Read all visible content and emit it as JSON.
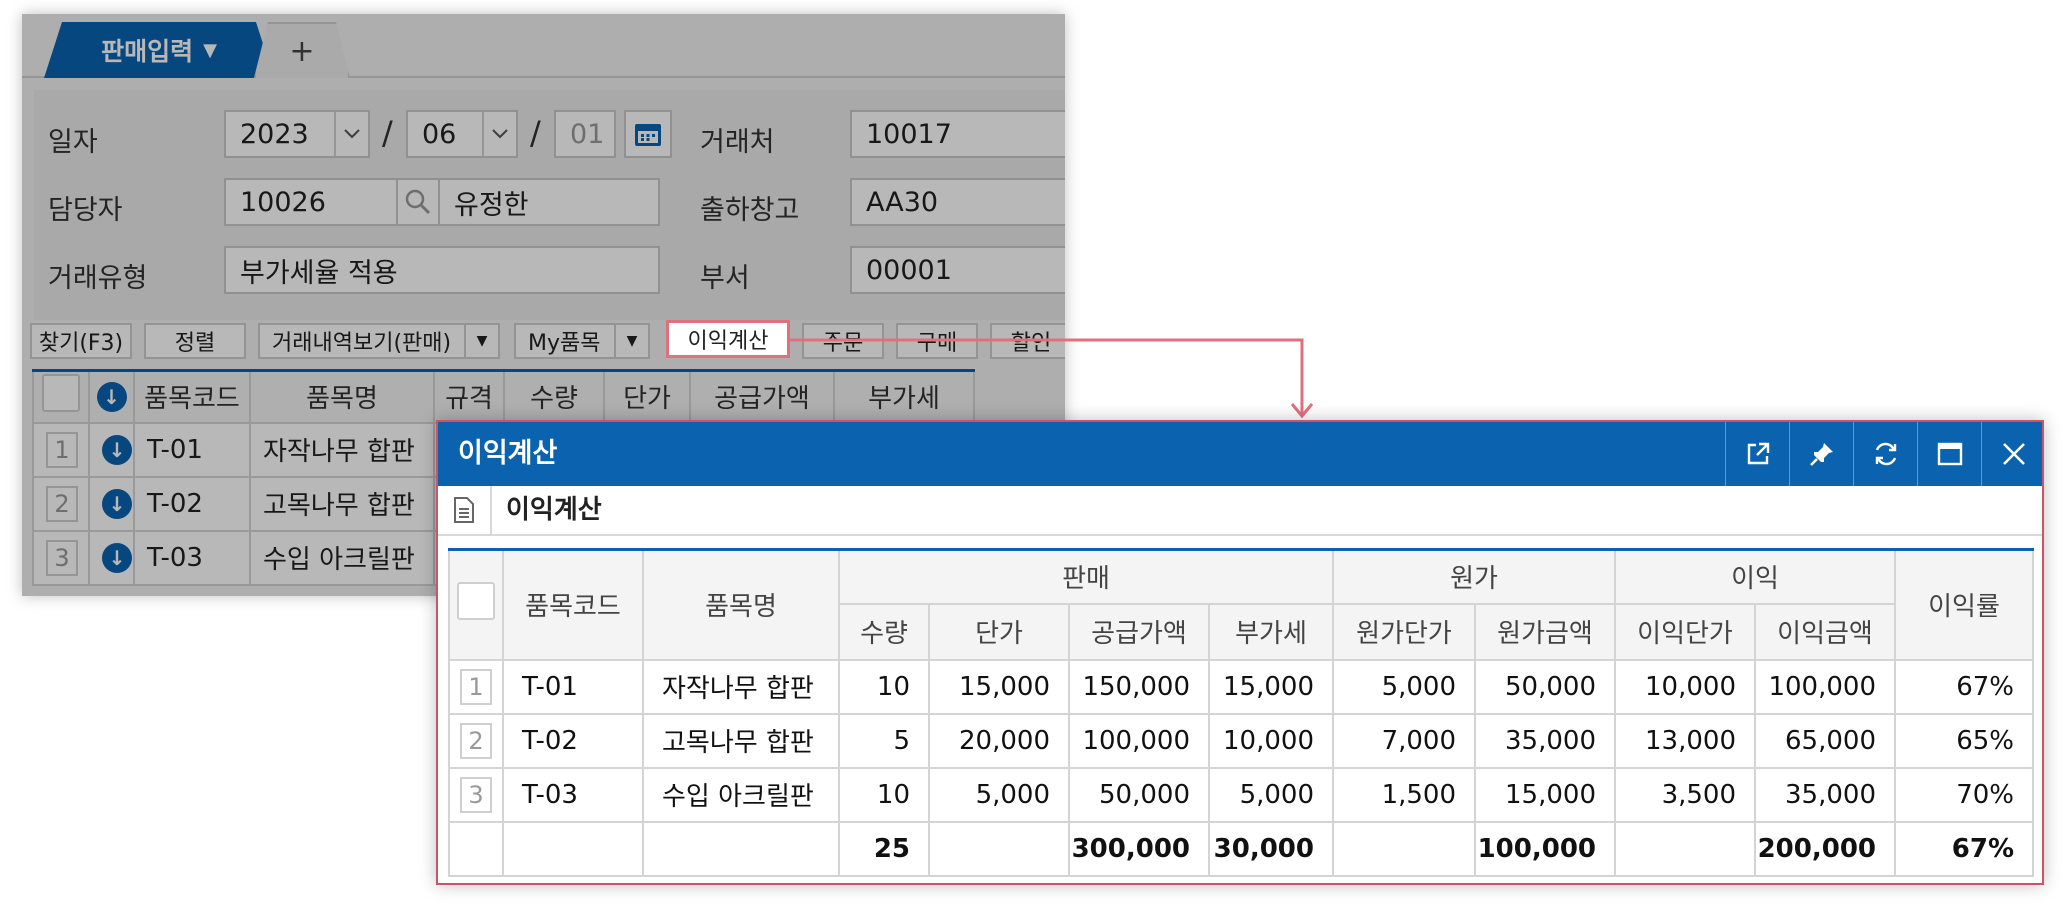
{
  "tabs": {
    "active_label": "판매입력",
    "add_label": "+"
  },
  "form": {
    "date_label": "일자",
    "year": "2023",
    "month": "06",
    "day": "01",
    "date_separator": "/",
    "client_label": "거래처",
    "client_value": "10017",
    "manager_label": "담당자",
    "manager_code": "10026",
    "manager_name": "유정한",
    "warehouse_label": "출하창고",
    "warehouse_value": "AA30",
    "trade_type_label": "거래유형",
    "trade_type_value": "부가세율 적용",
    "dept_label": "부서",
    "dept_value": "00001"
  },
  "toolbar": {
    "find": "찾기(F3)",
    "sort": "정렬",
    "history": "거래내역보기(판매)",
    "my_items": "My품목",
    "profit_calc": "이익계산",
    "order": "주문",
    "purchase": "구매",
    "discount": "할인"
  },
  "bg_grid": {
    "headers": [
      "품목코드",
      "품목명",
      "규격",
      "수량",
      "단가",
      "공급가액",
      "부가세"
    ],
    "rows": [
      {
        "num": "1",
        "code": "T-01",
        "name": "자작나무 합판"
      },
      {
        "num": "2",
        "code": "T-02",
        "name": "고목나무 합판"
      },
      {
        "num": "3",
        "code": "T-03",
        "name": "수입 아크릴판"
      }
    ]
  },
  "popup": {
    "title": "이익계산",
    "subtitle": "이익계산",
    "header_icons": [
      "external-link-icon",
      "pin-icon",
      "refresh-icon",
      "maximize-icon",
      "close-icon"
    ],
    "group_headers": {
      "code": "품목코드",
      "name": "품목명",
      "sales": "판매",
      "cost": "원가",
      "profit": "이익",
      "rate": "이익률"
    },
    "sub_headers": [
      "수량",
      "단가",
      "공급가액",
      "부가세",
      "원가단가",
      "원가금액",
      "이익단가",
      "이익금액"
    ],
    "rows": [
      {
        "num": "1",
        "code": "T-01",
        "name": "자작나무 합판",
        "qty": "10",
        "price": "15,000",
        "supply": "150,000",
        "vat": "15,000",
        "cost_unit": "5,000",
        "cost_amt": "50,000",
        "profit_unit": "10,000",
        "profit_amt": "100,000",
        "rate": "67%"
      },
      {
        "num": "2",
        "code": "T-02",
        "name": "고목나무 합판",
        "qty": "5",
        "price": "20,000",
        "supply": "100,000",
        "vat": "10,000",
        "cost_unit": "7,000",
        "cost_amt": "35,000",
        "profit_unit": "13,000",
        "profit_amt": "65,000",
        "rate": "65%"
      },
      {
        "num": "3",
        "code": "T-03",
        "name": "수입 아크릴판",
        "qty": "10",
        "price": "5,000",
        "supply": "50,000",
        "vat": "5,000",
        "cost_unit": "1,500",
        "cost_amt": "15,000",
        "profit_unit": "3,500",
        "profit_amt": "35,000",
        "rate": "70%"
      }
    ],
    "totals": {
      "qty": "25",
      "supply": "300,000",
      "vat": "30,000",
      "cost_amt": "100,000",
      "profit_amt": "200,000",
      "rate": "67%"
    }
  },
  "colors": {
    "primary": "#0b63b0",
    "highlight": "#e0707e",
    "popup_border": "#c8566a"
  }
}
